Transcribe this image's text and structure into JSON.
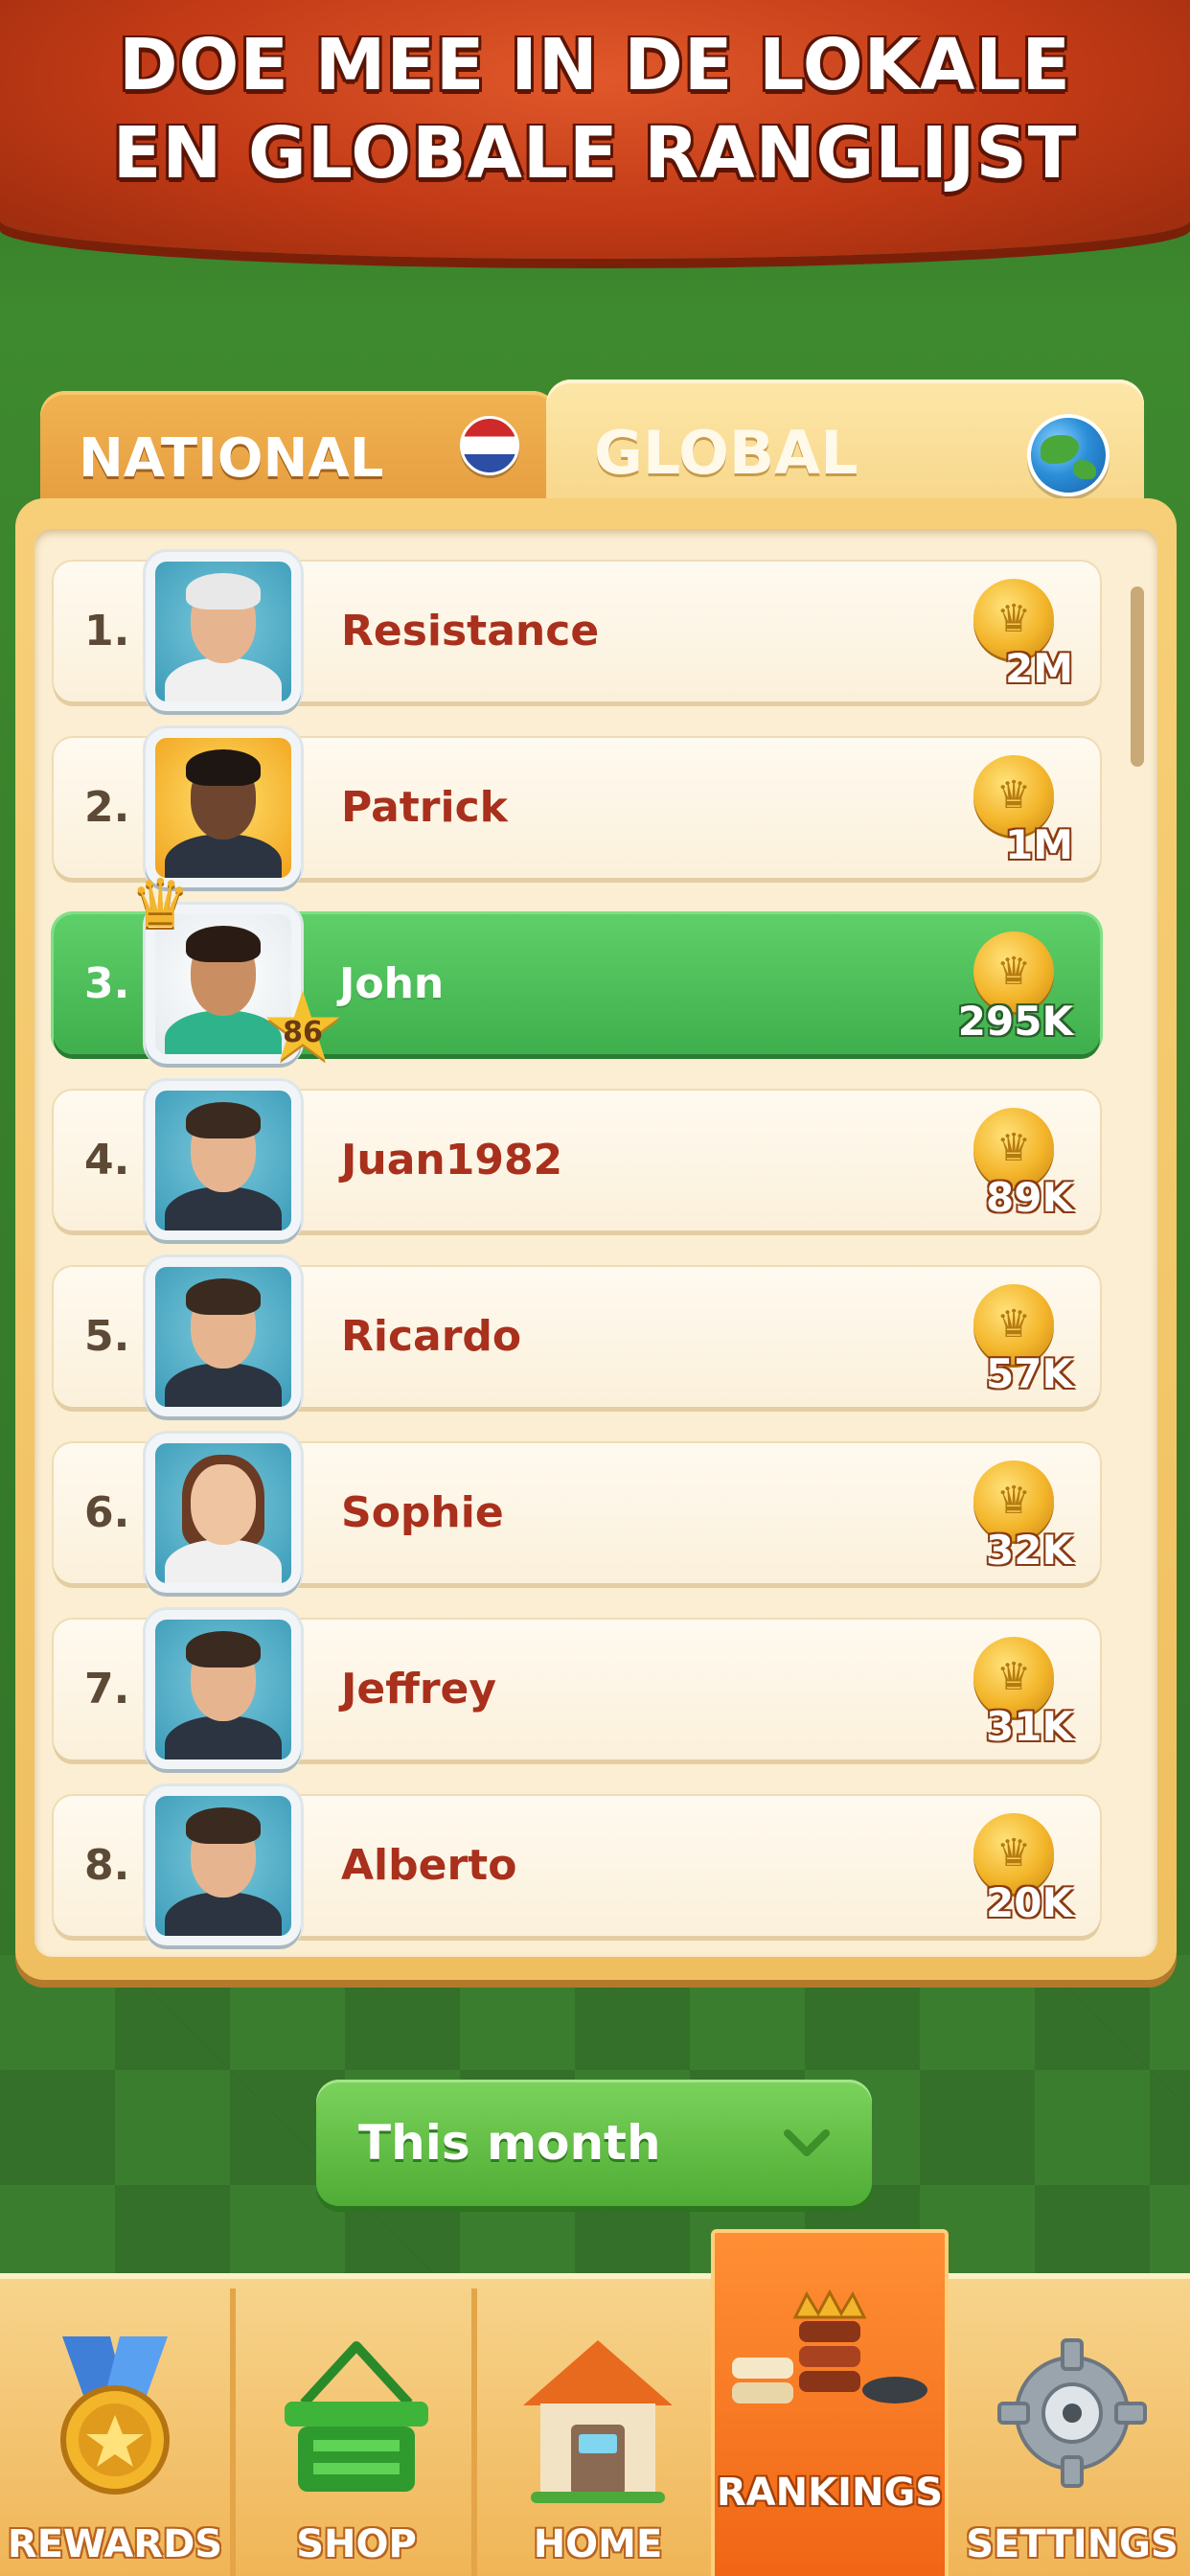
{
  "header": {
    "line1": "DOE MEE IN DE LOKALE",
    "line2": "EN GLOBALE RANGLIJST"
  },
  "tabs": [
    {
      "label": "NATIONAL",
      "icon": "netherlands-flag-icon",
      "active": false
    },
    {
      "label": "GLOBAL",
      "icon": "globe-icon",
      "active": true
    }
  ],
  "leaderboard": [
    {
      "rank": "1.",
      "name": "Resistance",
      "score": "2M"
    },
    {
      "rank": "2.",
      "name": "Patrick",
      "score": "1M"
    },
    {
      "rank": "3.",
      "name": "John",
      "score": "295K",
      "level": "86",
      "highlight": true
    },
    {
      "rank": "4.",
      "name": "Juan1982",
      "score": "89K"
    },
    {
      "rank": "5.",
      "name": "Ricardo",
      "score": "57K"
    },
    {
      "rank": "6.",
      "name": "Sophie",
      "score": "32K"
    },
    {
      "rank": "7.",
      "name": "Jeffrey",
      "score": "31K"
    },
    {
      "rank": "8.",
      "name": "Alberto",
      "score": "20K"
    }
  ],
  "period": {
    "selected": "This month"
  },
  "nav": [
    {
      "label": "REWARDS",
      "icon": "medal-icon"
    },
    {
      "label": "SHOP",
      "icon": "basket-icon"
    },
    {
      "label": "HOME",
      "icon": "house-icon"
    },
    {
      "label": "RANKINGS",
      "icon": "checkers-crown-icon",
      "active": true
    },
    {
      "label": "SETTINGS",
      "icon": "gear-icon"
    }
  ],
  "colors": {
    "header": "#c23a16",
    "highlight_row": "#4cbc57",
    "name_text": "#a8301c",
    "active_nav": "#f06515"
  }
}
